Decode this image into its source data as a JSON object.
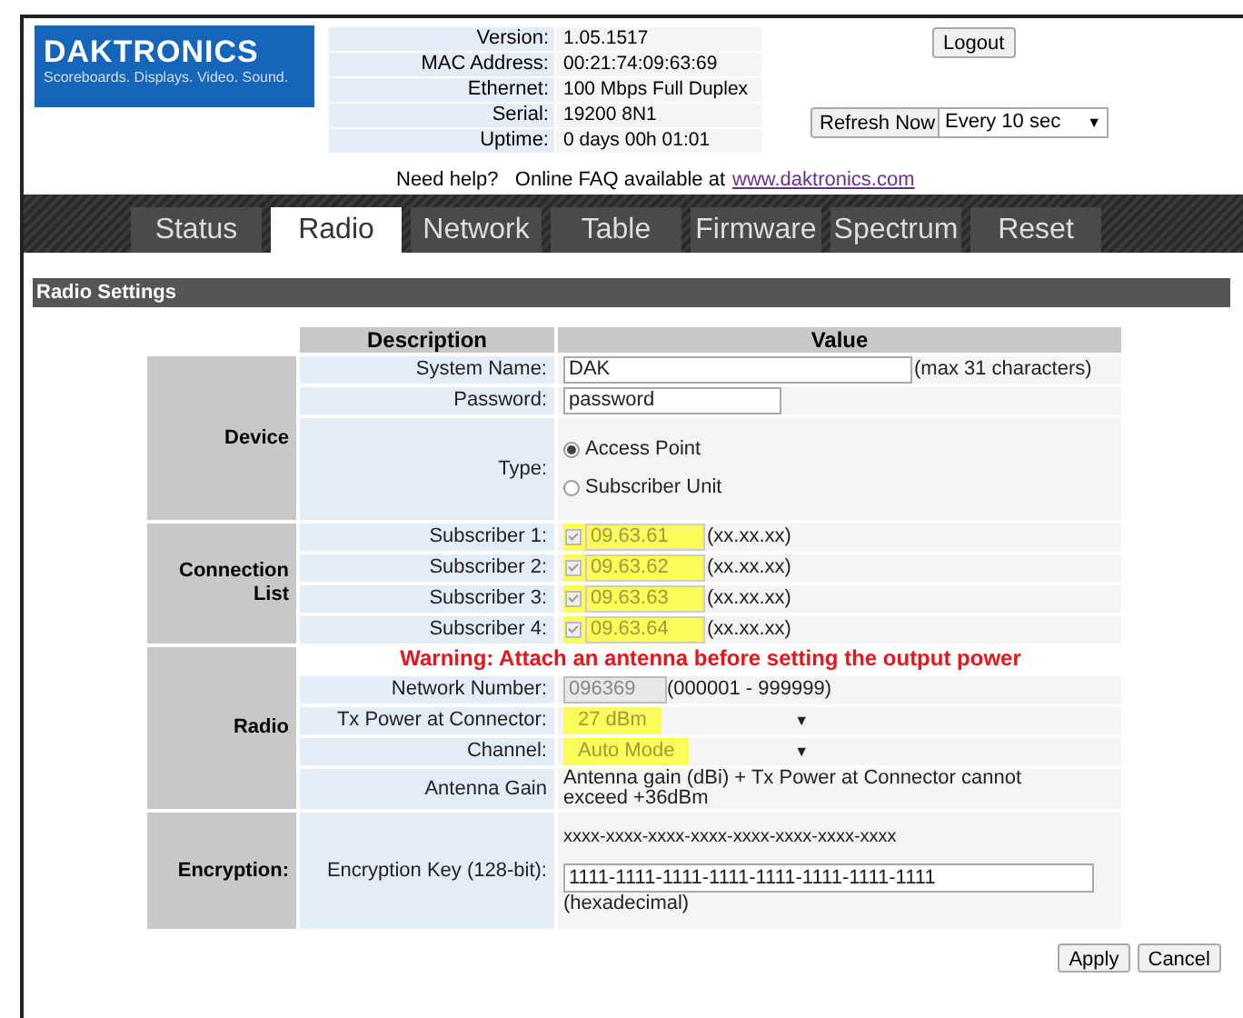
{
  "logo": {
    "name": "DAKTRONICS",
    "tagline": "Scoreboards. Displays. Video. Sound."
  },
  "info": [
    {
      "label": "Version:",
      "value": "1.05.1517"
    },
    {
      "label": "MAC Address:",
      "value": "00:21:74:09:63:69"
    },
    {
      "label": "Ethernet:",
      "value": "100 Mbps Full Duplex"
    },
    {
      "label": "Serial:",
      "value": "19200 8N1"
    },
    {
      "label": "Uptime:",
      "value": "0 days 00h 01:01"
    }
  ],
  "logout_button": "Logout",
  "refresh_button": "Refresh Now",
  "refresh_select": {
    "value": "Every 10 sec",
    "arrow": "▼"
  },
  "help": {
    "text": "Need help?   Online FAQ available at",
    "link": "www.daktronics.com"
  },
  "tabs": [
    {
      "label": "Status",
      "selected": false
    },
    {
      "label": "Radio",
      "selected": true
    },
    {
      "label": "Network",
      "selected": false
    },
    {
      "label": "Table",
      "selected": false
    },
    {
      "label": "Firmware",
      "selected": false
    },
    {
      "label": "Spectrum",
      "selected": false
    },
    {
      "label": "Reset",
      "selected": false
    }
  ],
  "section_title": "Radio Settings",
  "columns": [
    "Description",
    "Value"
  ],
  "groups": [
    {
      "label": "Device",
      "rows": [
        {
          "kind": "text",
          "label": "System Name:",
          "value": "DAK",
          "note": "(max 31 characters)",
          "wide": true
        },
        {
          "kind": "text",
          "label": "Password:",
          "value": "password"
        },
        {
          "kind": "radio",
          "label": "Type:",
          "options": [
            {
              "label": "Access Point",
              "selected": true
            },
            {
              "label": "Subscriber Unit",
              "selected": false
            }
          ]
        }
      ]
    },
    {
      "label": "Connection List",
      "rows": [
        {
          "kind": "subscriber",
          "label": "Subscriber 1:",
          "checked": true,
          "value": "09.63.61",
          "note": "(xx.xx.xx)",
          "highlighted": true
        },
        {
          "kind": "subscriber",
          "label": "Subscriber 2:",
          "checked": true,
          "value": "09.63.62",
          "note": "(xx.xx.xx)",
          "highlighted": true
        },
        {
          "kind": "subscriber",
          "label": "Subscriber 3:",
          "checked": true,
          "value": "09.63.63",
          "note": "(xx.xx.xx)",
          "highlighted": true
        },
        {
          "kind": "subscriber",
          "label": "Subscriber 4:",
          "checked": true,
          "value": "09.63.64",
          "note": "(xx.xx.xx)",
          "highlighted": true
        }
      ]
    },
    {
      "label": "Radio",
      "rows": [
        {
          "kind": "warning",
          "text": "Warning: Attach an antenna before setting the output power"
        },
        {
          "kind": "disabled",
          "label": "Network Number:",
          "value": "096369",
          "note": "(000001 - 999999)"
        },
        {
          "kind": "select",
          "label": "Tx Power at Connector:",
          "value": "27 dBm",
          "arrow": "▼",
          "highlighted": true
        },
        {
          "kind": "select",
          "label": "Channel:",
          "value": "Auto Mode",
          "arrow": "▼",
          "highlighted": true
        },
        {
          "kind": "info",
          "label": "Antenna Gain",
          "text": "Antenna gain (dBi) + Tx Power at Connector cannot exceed +36dBm"
        }
      ]
    },
    {
      "label": "Encryption:",
      "rows": [
        {
          "kind": "key",
          "label": "Encryption Key (128-bit):",
          "format": "xxxx-xxxx-xxxx-xxxx-xxxx-xxxx-xxxx-xxxx",
          "value": "1111-1111-1111-1111-1111-1111-1111-1111",
          "note": "(hexadecimal)"
        }
      ]
    }
  ],
  "buttons": [
    "Apply",
    "Cancel"
  ]
}
